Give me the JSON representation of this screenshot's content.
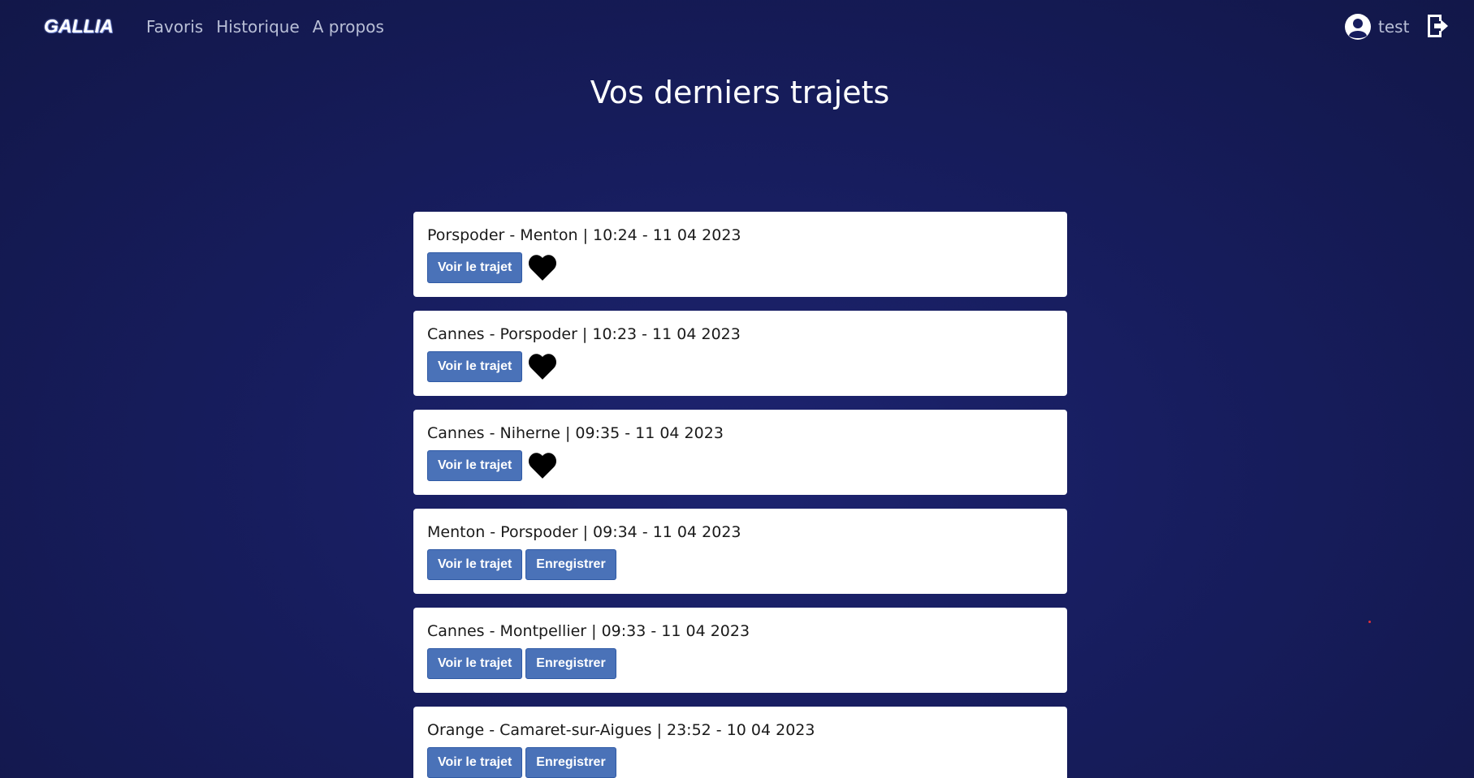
{
  "nav": {
    "brand": "GALLIA",
    "links": [
      "Favoris",
      "Historique",
      "A propos"
    ],
    "user_name": "test",
    "icons": {
      "user": "user-circle-icon",
      "logout": "logout-icon"
    }
  },
  "page_title": "Vos derniers trajets",
  "labels": {
    "view_trip": "Voir le trajet",
    "save": "Enregistrer"
  },
  "trips": [
    {
      "title": "Porspoder - Menton | 10:24 - 11 04 2023",
      "favorite": true
    },
    {
      "title": "Cannes - Porspoder | 10:23 - 11 04 2023",
      "favorite": true
    },
    {
      "title": "Cannes - Niherne | 09:35 - 11 04 2023",
      "favorite": true
    },
    {
      "title": "Menton - Porspoder | 09:34 - 11 04 2023",
      "favorite": false
    },
    {
      "title": "Cannes - Montpellier | 09:33 - 11 04 2023",
      "favorite": false
    },
    {
      "title": "Orange - Camaret-sur-Aigues | 23:52 - 10 04 2023",
      "favorite": false
    }
  ],
  "colors": {
    "background": "#171d5e",
    "button": "#4a72b8",
    "card": "#ffffff"
  }
}
